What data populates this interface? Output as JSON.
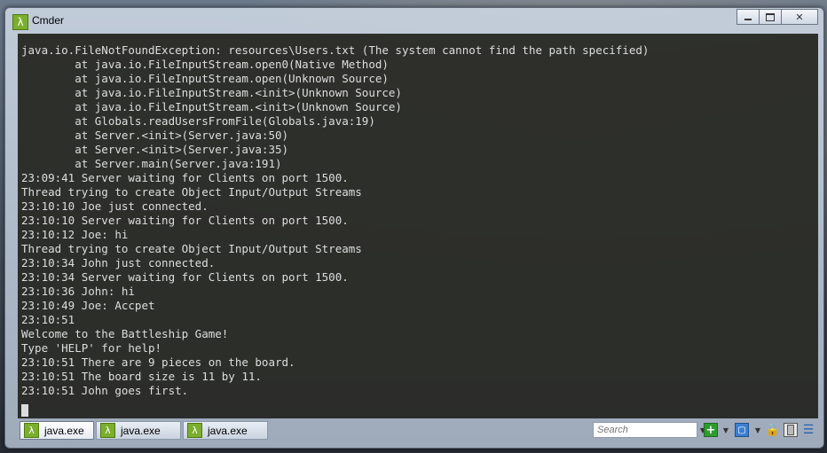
{
  "window": {
    "title": "Cmder",
    "app_icon_glyph": "λ"
  },
  "controls": {
    "minimize_icon": "minimize-icon",
    "maximize_icon": "maximize-icon",
    "close_glyph": "✕"
  },
  "terminal": {
    "lines": [
      "java.io.FileNotFoundException: resources\\Users.txt (The system cannot find the path specified)",
      "        at java.io.FileInputStream.open0(Native Method)",
      "        at java.io.FileInputStream.open(Unknown Source)",
      "        at java.io.FileInputStream.<init>(Unknown Source)",
      "        at java.io.FileInputStream.<init>(Unknown Source)",
      "        at Globals.readUsersFromFile(Globals.java:19)",
      "        at Server.<init>(Server.java:50)",
      "        at Server.<init>(Server.java:35)",
      "        at Server.main(Server.java:191)",
      "23:09:41 Server waiting for Clients on port 1500.",
      "Thread trying to create Object Input/Output Streams",
      "23:10:10 Joe just connected.",
      "23:10:10 Server waiting for Clients on port 1500.",
      "23:10:12 Joe: hi",
      "Thread trying to create Object Input/Output Streams",
      "23:10:34 John just connected.",
      "23:10:34 Server waiting for Clients on port 1500.",
      "23:10:36 John: hi",
      "23:10:49 Joe: Accpet",
      "23:10:51",
      "Welcome to the Battleship Game!",
      "Type 'HELP' for help!",
      "23:10:51 There are 9 pieces on the board.",
      "23:10:51 The board size is 11 by 11.",
      "23:10:51 John goes first."
    ]
  },
  "tabs": [
    {
      "label": "java.exe",
      "icon": "λ",
      "active": true
    },
    {
      "label": "java.exe",
      "icon": "λ",
      "active": false
    },
    {
      "label": "java.exe",
      "icon": "λ",
      "active": false
    }
  ],
  "toolbar": {
    "search_placeholder": "Search",
    "plus_glyph": "+",
    "dropdown_glyph": "▼",
    "split_glyph": "▢",
    "lock_glyph": "🔒",
    "menu_glyph": "☰"
  }
}
